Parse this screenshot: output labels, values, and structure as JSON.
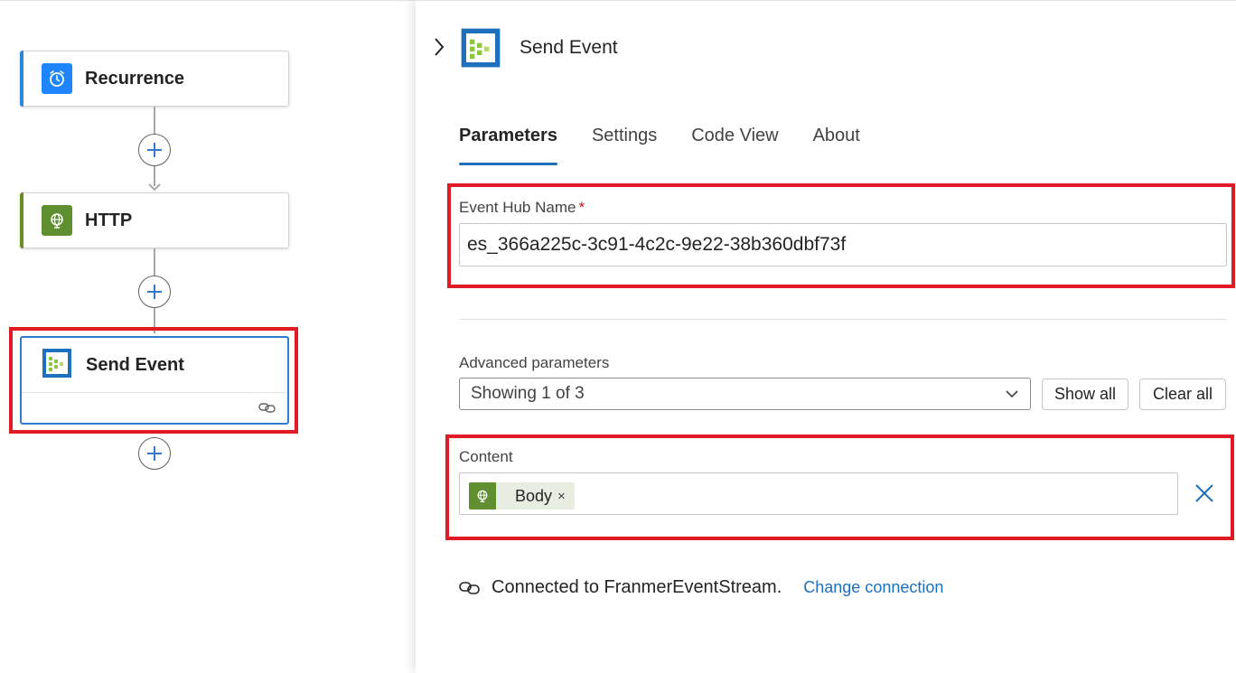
{
  "canvas": {
    "nodes": [
      {
        "label": "Recurrence",
        "accent": "#2b88d8",
        "icon": "alarm-clock-icon",
        "icon_bg": "#1f85ff"
      },
      {
        "label": "HTTP",
        "accent": "#6b8e23",
        "icon": "globe-icon",
        "icon_bg": "#5f8f2e"
      },
      {
        "label": "Send Event",
        "accent": "#2e7bcf",
        "icon": "event-hub-icon"
      }
    ],
    "add_step_icon": "plus-icon",
    "connection_icon": "link-icon"
  },
  "panel": {
    "title": "Send Event",
    "tabs": [
      {
        "label": "Parameters",
        "active": true
      },
      {
        "label": "Settings",
        "active": false
      },
      {
        "label": "Code View",
        "active": false
      },
      {
        "label": "About",
        "active": false
      }
    ],
    "event_hub": {
      "label": "Event Hub Name",
      "required_mark": "*",
      "value": "es_366a225c-3c91-4c2c-9e22-38b360dbf73f"
    },
    "advanced": {
      "label": "Advanced parameters",
      "selected": "Showing 1 of 3",
      "show_all": "Show all",
      "clear_all": "Clear all"
    },
    "content": {
      "label": "Content",
      "token_label": "Body",
      "token_remove": "×"
    },
    "connection": {
      "text": "Connected to FranmerEventStream.",
      "change_link": "Change connection"
    }
  },
  "colors": {
    "highlight": "#e01b24",
    "accent_blue": "#1f6fbf"
  }
}
